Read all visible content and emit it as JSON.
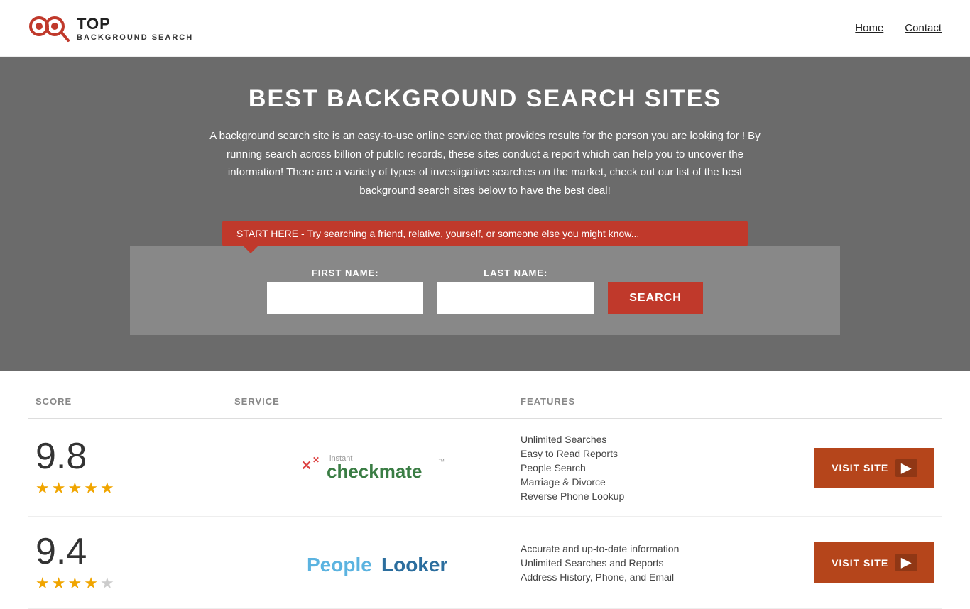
{
  "header": {
    "logo_top": "TOP",
    "logo_sub": "BACKGROUND SEARCH",
    "nav": [
      {
        "label": "Home",
        "href": "#"
      },
      {
        "label": "Contact",
        "href": "#"
      }
    ]
  },
  "hero": {
    "title": "BEST BACKGROUND SEARCH SITES",
    "description": "A background search site is an easy-to-use online service that provides results  for the person you are looking for ! By  running  search across billion of public records, these sites conduct  a report which can help you to uncover the information! There are a variety of types of investigative searches on the market, check out our  list of the best background search sites below to have the best deal!",
    "search_banner": "START HERE - Try searching a friend, relative, yourself, or someone else you might know..."
  },
  "search_form": {
    "first_name_label": "FIRST NAME:",
    "last_name_label": "LAST NAME:",
    "first_name_placeholder": "",
    "last_name_placeholder": "",
    "search_button_label": "SEARCH"
  },
  "table": {
    "headers": [
      "SCORE",
      "SERVICE",
      "FEATURES",
      ""
    ],
    "rows": [
      {
        "score": "9.8",
        "stars": 5,
        "service_name": "Instant Checkmate",
        "features": [
          "Unlimited Searches",
          "Easy to Read Reports",
          "People Search",
          "Marriage & Divorce",
          "Reverse Phone Lookup"
        ],
        "visit_label": "VISIT SITE"
      },
      {
        "score": "9.4",
        "stars": 4,
        "service_name": "PeopleLooker",
        "features": [
          "Accurate and up-to-date information",
          "Unlimited Searches and Reports",
          "Address History, Phone, and Email"
        ],
        "visit_label": "VISIT SITE"
      }
    ]
  }
}
